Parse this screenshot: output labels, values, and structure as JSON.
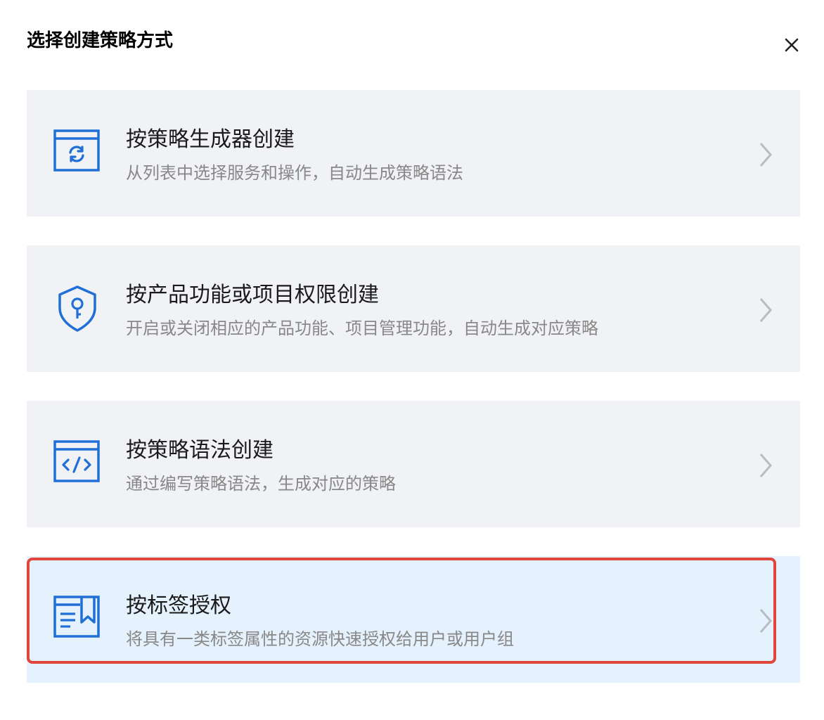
{
  "dialog": {
    "title": "选择创建策略方式",
    "close_icon": "close-icon"
  },
  "options": [
    {
      "title": "按策略生成器创建",
      "description": "从列表中选择服务和操作，自动生成策略语法",
      "icon": "refresh-window-icon",
      "selected": false
    },
    {
      "title": "按产品功能或项目权限创建",
      "description": "开启或关闭相应的产品功能、项目管理功能，自动生成对应策略",
      "icon": "shield-key-icon",
      "selected": false
    },
    {
      "title": "按策略语法创建",
      "description": "通过编写策略语法，生成对应的策略",
      "icon": "code-window-icon",
      "selected": false
    },
    {
      "title": "按标签授权",
      "description": "将具有一类标签属性的资源快速授权给用户或用户组",
      "icon": "tag-document-icon",
      "selected": true
    }
  ],
  "colors": {
    "accent": "#1f6fd6",
    "card_background": "#f0f2f5",
    "selected_background": "#e5f1fc",
    "highlight_border": "#e0463c",
    "title_text": "#1a1a1a",
    "description_text": "#888888",
    "chevron": "#b8bcc2"
  }
}
